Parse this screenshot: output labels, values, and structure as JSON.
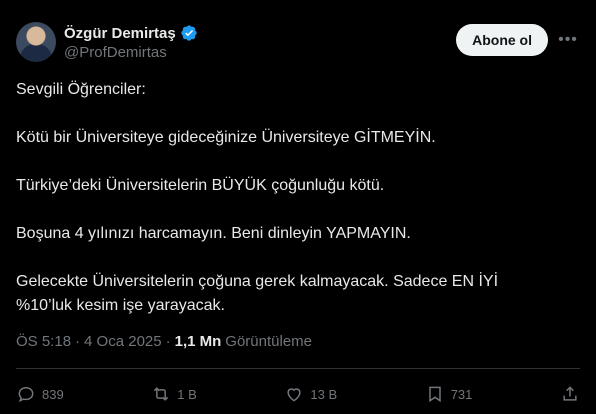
{
  "author": {
    "display_name": "Özgür Demirtaş",
    "handle": "@ProfDemirtas"
  },
  "follow_label": "Abone ol",
  "tweet": {
    "paragraphs": [
      "Sevgili Öğrenciler:",
      "Kötü bir Üniversiteye gideceğinize Üniversiteye GİTMEYİN.",
      "Türkiye’deki Üniversitelerin BÜYÜK çoğunluğu kötü.",
      "Boşuna 4 yılınızı harcamayın. Beni dinleyin YAPMAYIN.",
      "Gelecekte Üniversitelerin çoğuna gerek kalmayacak. Sadece EN İYİ\n%10’luk kesim işe yarayacak."
    ]
  },
  "meta": {
    "time": "ÖS 5:18",
    "separator": "·",
    "date": "4 Oca 2025",
    "views_count": "1,1 Mn",
    "views_label": "Görüntüleme"
  },
  "actions": {
    "replies": "839",
    "reposts": "1 B",
    "likes": "13 B",
    "bookmarks": "731"
  },
  "colors": {
    "background": "#000000",
    "text": "#e7e9ea",
    "muted": "#71767b",
    "verified": "#1d9bf0",
    "button_bg": "#eff3f4"
  },
  "icons": [
    "verified-badge-icon",
    "more-icon",
    "reply-icon",
    "repost-icon",
    "like-icon",
    "bookmark-icon",
    "share-icon"
  ]
}
